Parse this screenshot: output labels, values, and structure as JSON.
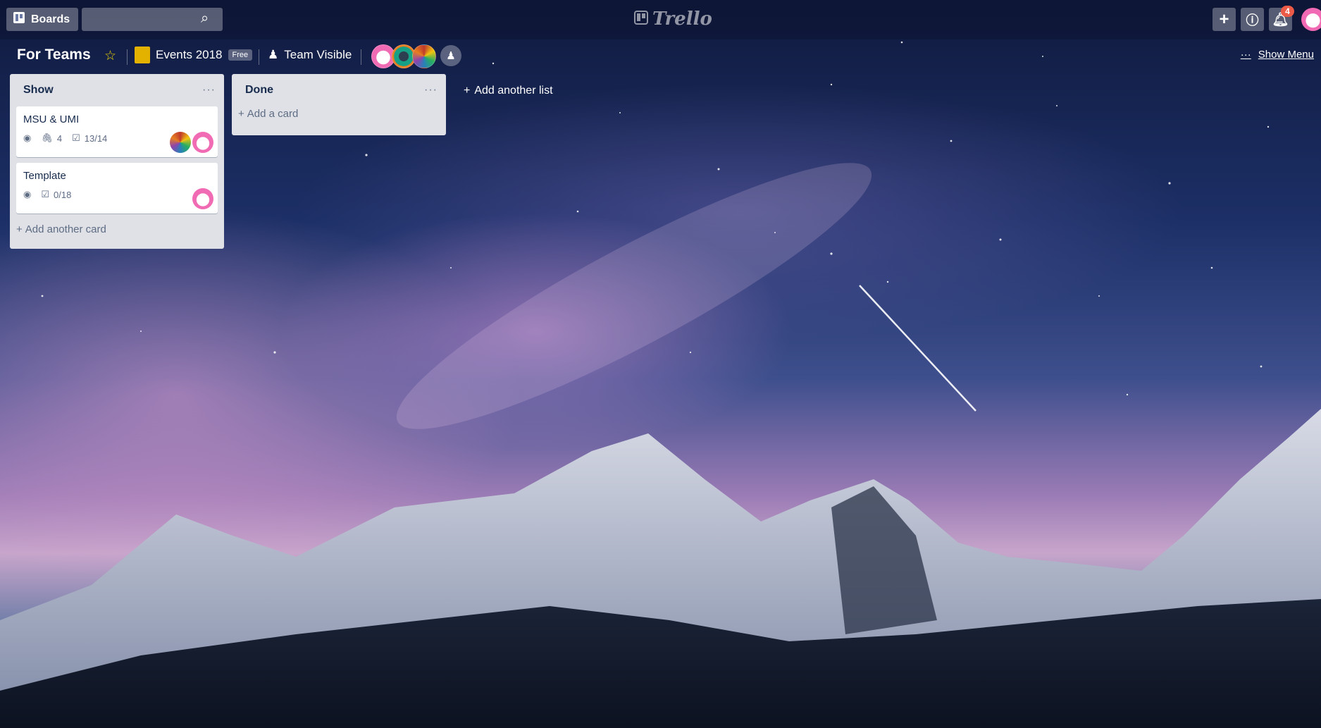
{
  "header": {
    "boards_label": "Boards",
    "search_placeholder": "",
    "logo_text": "Trello",
    "notification_count": "4"
  },
  "board": {
    "title": "For Teams",
    "team_name": "Events 2018",
    "team_plan": "Free",
    "visibility": "Team Visible",
    "show_menu": "Show Menu"
  },
  "lists": [
    {
      "title": "Show",
      "cards": [
        {
          "title": "MSU & UMI",
          "attachments": "4",
          "checklist": "13/14"
        },
        {
          "title": "Template",
          "checklist": "0/18"
        }
      ],
      "add_label": "Add another card"
    },
    {
      "title": "Done",
      "cards": [],
      "add_label": "Add a card"
    }
  ],
  "add_list_label": "Add another list",
  "colors": {
    "star": "#f2d600",
    "notification_badge": "#eb5a46",
    "list_bg": "#dfe1e6"
  },
  "icons": [
    "board-icon",
    "search-icon",
    "trello-logo-icon",
    "plus-icon",
    "info-icon",
    "bell-icon",
    "star-icon",
    "team-icon",
    "visibility-icon",
    "invite-icon",
    "ellipsis-icon",
    "eye-icon",
    "paperclip-icon",
    "checklist-icon"
  ]
}
